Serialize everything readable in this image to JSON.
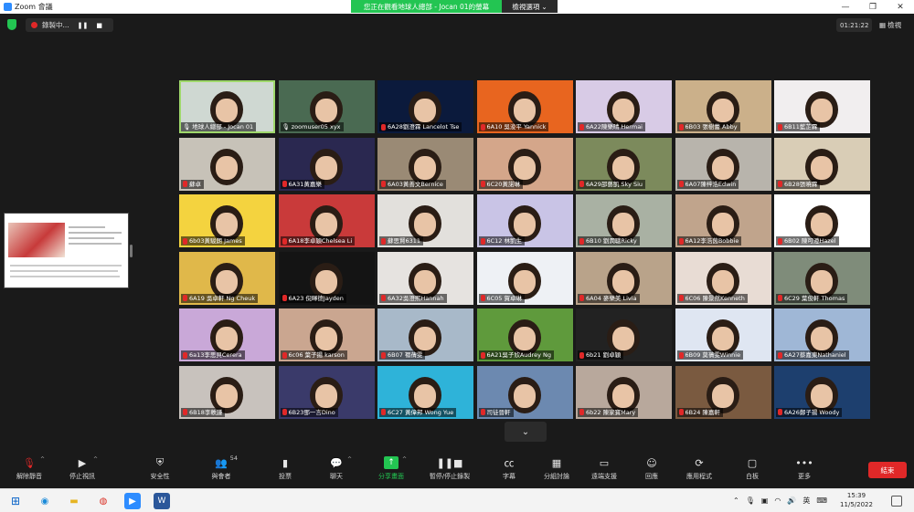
{
  "window": {
    "app_title": "Zoom 會議"
  },
  "share_banner": {
    "text": "您正在觀看地球人總部 - Jocan 01的螢幕",
    "options_label": "檢視選項"
  },
  "window_controls": {
    "minimize": "—",
    "maximize": "❐",
    "close": "✕"
  },
  "recording": {
    "status": "錄製中..."
  },
  "meeting": {
    "elapsed": "01:21:22",
    "view_label": "檢視"
  },
  "tiles": [
    {
      "name": "地球人總部 - Jocan 01",
      "bg": "#cfd8d2",
      "muted": false,
      "active": true
    },
    {
      "name": "zoomuser05 xyx",
      "bg": "#4a6a52",
      "muted": false
    },
    {
      "name": "6A28劉澄霖 Lancelot Tse",
      "bg": "#0b1a3c",
      "muted": true
    },
    {
      "name": "6A10 吳浚平 Yannick",
      "bg": "#e8651f",
      "muted": true
    },
    {
      "name": "6A22陳樂晴 Hermai",
      "bg": "#d8cbe6",
      "muted": true
    },
    {
      "name": "6B03 張樹蕾 Abby",
      "bg": "#cbb08a",
      "muted": true
    },
    {
      "name": "6B11藍芷霖",
      "bg": "#f1eeef",
      "muted": true
    },
    {
      "name": "蘇卓",
      "bg": "#c7c2b8",
      "muted": true
    },
    {
      "name": "6A31黃嘉樂",
      "bg": "#2a2850",
      "muted": true
    },
    {
      "name": "6A03黃善文Bernice",
      "bg": "#9a8a75",
      "muted": true
    },
    {
      "name": "6C20黃諾琳",
      "bg": "#d4a68a",
      "muted": true
    },
    {
      "name": "6A29邵藝凱 Sky Siu",
      "bg": "#7c8a5c",
      "muted": true
    },
    {
      "name": "6A07陳梓浩Edwin",
      "bg": "#b8b4ac",
      "muted": true
    },
    {
      "name": "6B28張曉霖",
      "bg": "#d9cdb6",
      "muted": true
    },
    {
      "name": "6b03黃駿朗 James",
      "bg": "#f4d33f",
      "muted": true
    },
    {
      "name": "6A18李卓穎Chelsea Li",
      "bg": "#c93a3a",
      "muted": true
    },
    {
      "name": "蘇思賢6311",
      "bg": "#e2e0dc",
      "muted": true
    },
    {
      "name": "6C12 林凱生",
      "bg": "#c9c4e6",
      "muted": true
    },
    {
      "name": "6B10 劉潤聰Ricky",
      "bg": "#a9b1a3",
      "muted": true
    },
    {
      "name": "6A12李浩茵Bobbie",
      "bg": "#c0a48c",
      "muted": true
    },
    {
      "name": "6B02 陳可澄Hazel",
      "bg": "#ffffff",
      "muted": true
    },
    {
      "name": "6A19 吳卓軒 Ng Cheuk",
      "bg": "#e0b84a",
      "muted": true
    },
    {
      "name": "6A23 倪暉德Jayden",
      "bg": "#141414",
      "muted": true
    },
    {
      "name": "6A32吳澄熙Hannah",
      "bg": "#e6e3e0",
      "muted": true
    },
    {
      "name": "6C05 賀卓琳",
      "bg": "#eef1f5",
      "muted": true
    },
    {
      "name": "6A04 麥樂美 Livia",
      "bg": "#b9a38a",
      "muted": true
    },
    {
      "name": "6C06 陳景然Kenneth",
      "bg": "#e8dcd4",
      "muted": true
    },
    {
      "name": "6C29 葉俊軒 Thomas",
      "bg": "#7f8c7a",
      "muted": true
    },
    {
      "name": "6a13李思貝Cerera",
      "bg": "#c9a8d8",
      "muted": true
    },
    {
      "name": "6c06 葉子揚 karson",
      "bg": "#caa690",
      "muted": true
    },
    {
      "name": "6B07 禤蒨雯",
      "bg": "#a8b9c9",
      "muted": true
    },
    {
      "name": "6A21吳子欣Audrey Ng",
      "bg": "#5f9a3c",
      "muted": true
    },
    {
      "name": "6b21 劉卓穎",
      "bg": "#222222",
      "muted": true
    },
    {
      "name": "6B09 莫蒨雯Winnie",
      "bg": "#dfe6f2",
      "muted": true
    },
    {
      "name": "6A27蔡嘉東Nathaniel",
      "bg": "#9fb7d6",
      "muted": true
    },
    {
      "name": "6B18李軼謙",
      "bg": "#c8c2bd",
      "muted": true
    },
    {
      "name": "6B23鄧一言Dino",
      "bg": "#3a3a6a",
      "muted": true
    },
    {
      "name": "6C27 黃偉邦 Wong Yue",
      "bg": "#2eb3d9",
      "muted": true
    },
    {
      "name": "司徒晉軒",
      "bg": "#6c89b0",
      "muted": true
    },
    {
      "name": "6b22 陳家寶Mary",
      "bg": "#b8a89c",
      "muted": true
    },
    {
      "name": "6B24 陳嘉軒",
      "bg": "#7a5a40",
      "muted": true
    },
    {
      "name": "6A26鄭子揚 Woody",
      "bg": "#1d3f6e",
      "muted": true
    }
  ],
  "toolbar": {
    "mute": "解除靜音",
    "video": "停止視訊",
    "security": "安全性",
    "participants": "與會者",
    "participants_count": "54",
    "polls": "投票",
    "chat": "聊天",
    "share": "分享畫面",
    "record": "暫停/停止錄製",
    "captions": "字幕",
    "breakout": "分組討論",
    "remote": "遠端支援",
    "reactions": "回應",
    "apps": "應用程式",
    "whiteboard": "白板",
    "more": "更多",
    "end": "結束"
  },
  "taskbar": {
    "time": "15:39",
    "date": "11/5/2022",
    "ime": "英"
  },
  "colors": {
    "accent_green": "#23c552",
    "end_red": "#e02828",
    "zoom_blue": "#2d8cff"
  }
}
